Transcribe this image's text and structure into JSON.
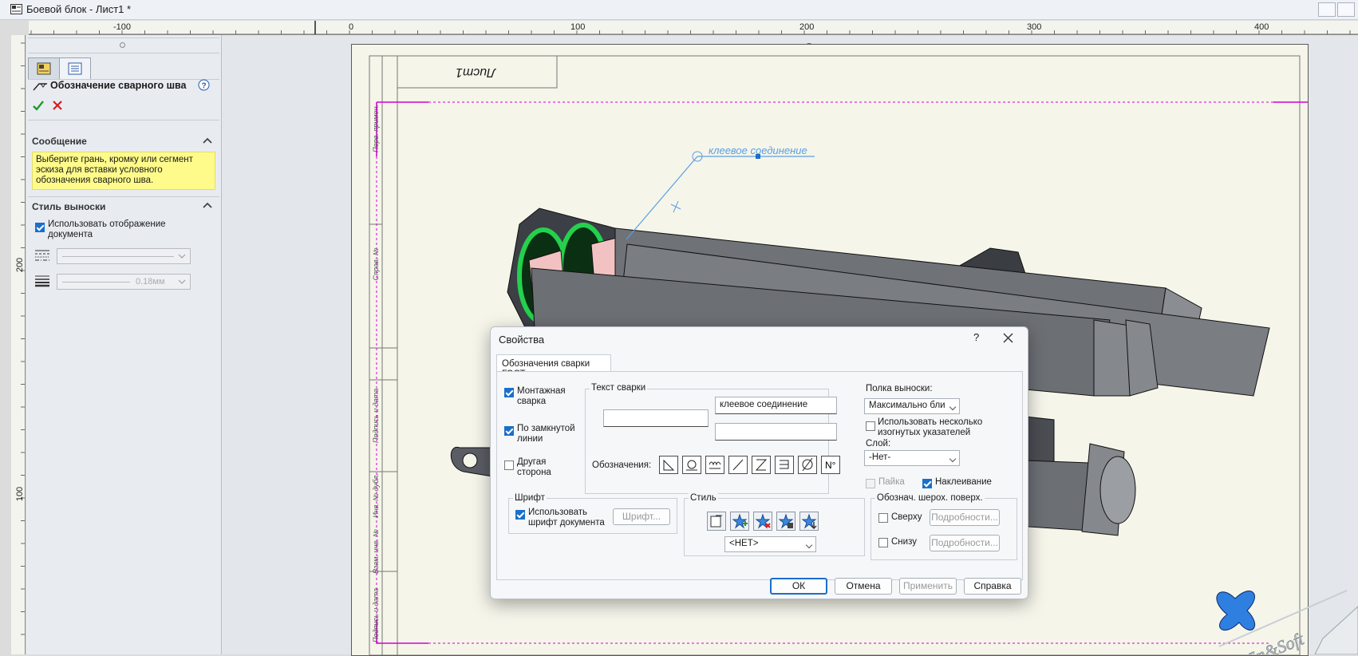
{
  "window": {
    "title": "Боевой блок - Лист1 *"
  },
  "ruler": {
    "h_labels": [
      "-100",
      "0",
      "100",
      "200",
      "300",
      "400"
    ],
    "v_labels": [
      "200",
      "100"
    ]
  },
  "panel": {
    "title": "Обозначение сварного шва",
    "message_header": "Сообщение",
    "message_text": "Выберите грань, кромку или сегмент эскиза для вставки условного обозначения сварного шва.",
    "leader_header": "Стиль выноски",
    "use_doc_display": "Использовать отображение документа",
    "line_width_value": "0.18мм"
  },
  "sheet": {
    "title_block_text": "Лист1",
    "side_labels": [
      "Перв. примен.",
      "Справ. №",
      "Подпись и дата",
      "Инв. № дубл.",
      "Взам. инв. №",
      "Подпись и дата"
    ],
    "annotation_text": "клеевое соединение"
  },
  "dialog": {
    "title": "Свойства",
    "help": "?",
    "tab": "Обозначения сварки ГОСТ",
    "mount_weld": "Монтажная сварка",
    "closed_line": "По замкнутой линии",
    "other_side": "Другая сторона",
    "weld_text_label": "Текст сварки",
    "weld_text_field1": "",
    "weld_text_field2": "клеевое соединение",
    "weld_text_field3": "",
    "designations_label": "Обозначения:",
    "leader_shelf_label": "Полка выноски:",
    "leader_shelf_value": "Максимально бли",
    "multi_leaders": "Использовать несколько изогнутых указателей",
    "layer_label": "Слой:",
    "layer_value": "-Нет-",
    "solder": "Пайка",
    "gluing": "Наклеивание",
    "font_group": "Шрифт",
    "use_doc_font": "Использовать шрифт документа",
    "font_button": "Шрифт...",
    "style_group": "Стиль",
    "style_value": "<НЕТ>",
    "roughness_group": "Обознач. шерох. поверх.",
    "top": "Сверху",
    "bottom": "Снизу",
    "details": "Подробности...",
    "ok": "ОК",
    "cancel": "Отмена",
    "apply": "Применить",
    "help_button": "Справка"
  },
  "watermark": "DeWin&Soft",
  "colors": {
    "accent": "#1a6fc9",
    "message_bg": "#fffb8a",
    "annotation": "#5aa0e0",
    "sheet_border_dash": "#d400d4"
  }
}
